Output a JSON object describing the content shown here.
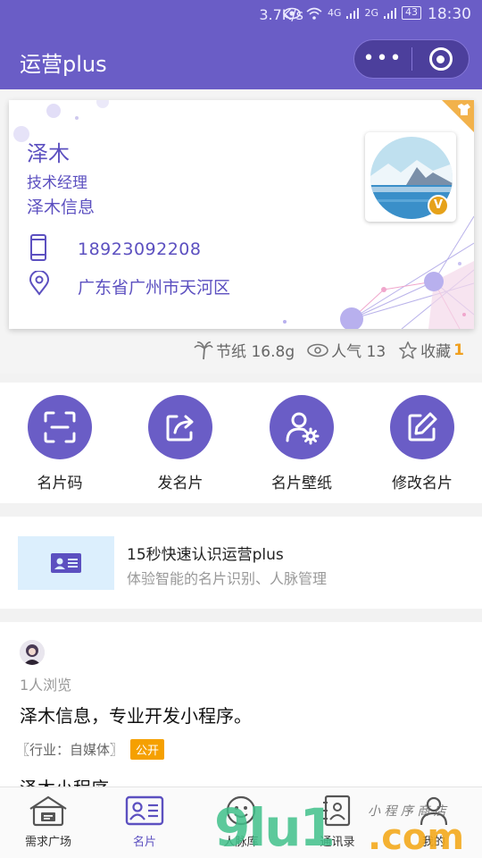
{
  "status_bar": {
    "network_speed": "3.7K/s",
    "signal_label_1": "4G",
    "signal_label_2": "2G",
    "battery": "43",
    "time": "18:30"
  },
  "nav": {
    "title": "运营plus",
    "more_glyph": "•••"
  },
  "card": {
    "name": "泽木",
    "job_title": "技术经理",
    "company": "泽木信息",
    "phone": "18923092208",
    "address": "广东省广州市天河区",
    "verified_badge": "V",
    "accent_color": "#5c50c0"
  },
  "stats": {
    "paper_saved_label": "节纸 16.8g",
    "popularity_label": "人气 13",
    "favorites_label": "收藏",
    "favorites_count": "1"
  },
  "actions": [
    {
      "label": "名片码",
      "icon": "scan-frame-icon"
    },
    {
      "label": "发名片",
      "icon": "share-arrow-icon"
    },
    {
      "label": "名片壁纸",
      "icon": "user-gear-icon"
    },
    {
      "label": "修改名片",
      "icon": "edit-pencil-icon"
    }
  ],
  "promo": {
    "title": "15秒快速认识运营plus",
    "subtitle": "体验智能的名片识别、人脉管理"
  },
  "feed": {
    "views": "1人浏览",
    "text": "泽木信息，专业开发小程序。",
    "industry": "〖行业：自媒体〗",
    "visibility_tag": "公开",
    "truncated_line": "泽木小程序"
  },
  "tabbar": [
    {
      "label": "需求广场",
      "icon": "store-icon",
      "active": false
    },
    {
      "label": "名片",
      "icon": "card-icon",
      "active": true
    },
    {
      "label": "人脉库",
      "icon": "contacts-icon",
      "active": false
    },
    {
      "label": "通讯录",
      "icon": "address-book-icon",
      "active": false
    },
    {
      "label": "我的",
      "icon": "profile-icon",
      "active": false
    }
  ],
  "watermark": {
    "brand": "9lu1.com",
    "handwriting": "小 程 序 商 店"
  },
  "colors": {
    "primary": "#6a5dc6",
    "tag_orange": "#f5a000",
    "badge_gold": "#e6a21a"
  }
}
